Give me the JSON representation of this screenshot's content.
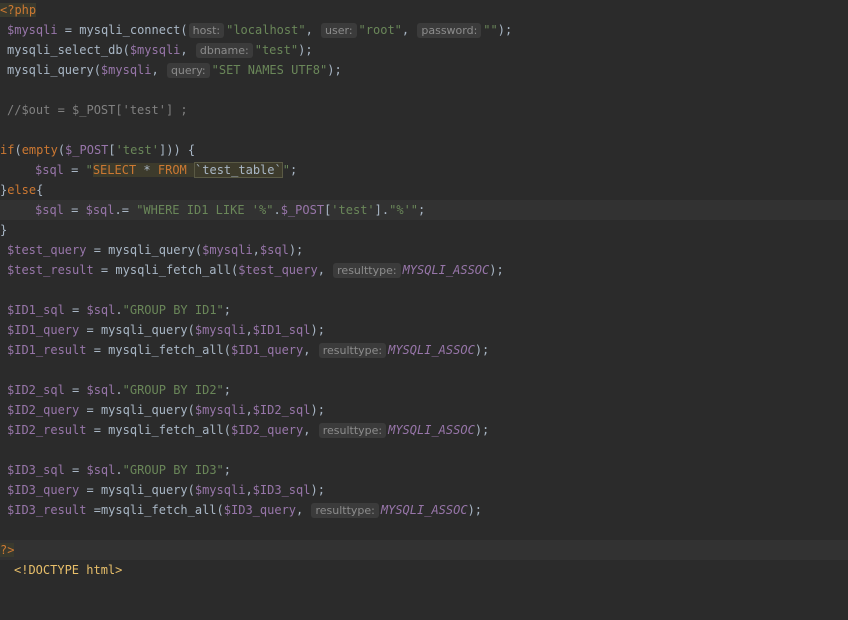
{
  "editor": {
    "lines": {
      "l1": {
        "open_tag": "<?php"
      },
      "l2": {
        "var": "$mysqli",
        "assign": " = ",
        "fn": "mysqli_connect(",
        "hint_host": "host:",
        "arg1": "\"localhost\"",
        "comma1": ", ",
        "hint_user": "user:",
        "arg2": "\"root\"",
        "comma2": ", ",
        "hint_password": "password:",
        "arg3": "\"\"",
        "close": ");"
      },
      "l3": {
        "fn": "mysqli_select_db(",
        "var": "$mysqli",
        "comma": ", ",
        "hint_dbname": "dbname:",
        "arg": "\"test\"",
        "close": ");"
      },
      "l4": {
        "fn": "mysqli_query(",
        "var": "$mysqli",
        "comma": ", ",
        "hint_query": "query:",
        "arg": "\"SET NAMES UTF8\"",
        "close": ");"
      },
      "l6": {
        "comment": "//$out = $_POST['test'] ;"
      },
      "l8": {
        "kw_if": "if",
        "open": "(",
        "fn_empty": "empty",
        "open2": "(",
        "var_post": "$_POST",
        "bracket_open": "[",
        "key": "'test'",
        "bracket_close": "]",
        "close": ")) {"
      },
      "l9": {
        "var": "$sql",
        "assign": " = ",
        "q_open": "\"",
        "sql_select": "SELECT",
        "sql_star": " * ",
        "sql_from": "FROM",
        "sql_space": " ",
        "sql_table": "`test_table`",
        "q_close": "\"",
        "semi": ";"
      },
      "l10": {
        "close_brace": "}",
        "kw_else": "else",
        "open_brace": "{"
      },
      "l11": {
        "var": "$sql",
        "assign": " = ",
        "var2": "$sql",
        "op": ".= ",
        "str1": "\"WHERE ID1 LIKE '%\"",
        "dot1": ".",
        "var_post": "$_POST",
        "b_open": "[",
        "key": "'test'",
        "b_close": "]",
        "dot2": ".",
        "str2": "\"%'\"",
        "semi": ";"
      },
      "l12": {
        "close_brace": "}"
      },
      "l13": {
        "var": "$test_query",
        "assign": " = ",
        "fn": "mysqli_query(",
        "arg1": "$mysqli",
        "comma": ",",
        "arg2": "$sql",
        "close": ");"
      },
      "l14": {
        "var": "$test_result",
        "assign": " = ",
        "fn": "mysqli_fetch_all(",
        "arg1": "$test_query",
        "comma": ", ",
        "hint": "resulttype:",
        "const": "MYSQLI_ASSOC",
        "close": ");"
      },
      "l16": {
        "var": "$ID1_sql",
        "assign": " = ",
        "var2": "$sql",
        "dot": ".",
        "str": "\"GROUP BY ID1\"",
        "semi": ";"
      },
      "l17": {
        "var": "$ID1_query",
        "assign": " = ",
        "fn": "mysqli_query(",
        "arg1": "$mysqli",
        "comma": ",",
        "arg2": "$ID1_sql",
        "close": ");"
      },
      "l18": {
        "var": "$ID1_result",
        "assign": " = ",
        "fn": "mysqli_fetch_all(",
        "arg1": "$ID1_query",
        "comma": ", ",
        "hint": "resulttype:",
        "const": "MYSQLI_ASSOC",
        "close": ");"
      },
      "l20": {
        "var": "$ID2_sql",
        "assign": " = ",
        "var2": "$sql",
        "dot": ".",
        "str": "\"GROUP BY ID2\"",
        "semi": ";"
      },
      "l21": {
        "var": "$ID2_query",
        "assign": " = ",
        "fn": "mysqli_query(",
        "arg1": "$mysqli",
        "comma": ",",
        "arg2": "$ID2_sql",
        "close": ");"
      },
      "l22": {
        "var": "$ID2_result",
        "assign": " = ",
        "fn": "mysqli_fetch_all(",
        "arg1": "$ID2_query",
        "comma": ", ",
        "hint": "resulttype:",
        "const": "MYSQLI_ASSOC",
        "close": ");"
      },
      "l24": {
        "var": "$ID3_sql",
        "assign": " = ",
        "var2": "$sql",
        "dot": ".",
        "str": "\"GROUP BY ID3\"",
        "semi": ";"
      },
      "l25": {
        "var": "$ID3_query",
        "assign": " = ",
        "fn": "mysqli_query(",
        "arg1": "$mysqli",
        "comma": ",",
        "arg2": "$ID3_sql",
        "close": ");"
      },
      "l26": {
        "var": "$ID3_result",
        "assign": " =",
        "fn": "mysqli_fetch_all(",
        "arg1": "$ID3_query",
        "comma": ", ",
        "hint": "resulttype:",
        "const": "MYSQLI_ASSOC",
        "close": ");"
      },
      "l28": {
        "close_tag": "?>"
      },
      "l29": {
        "partial": "<!DOCTYPE html>"
      }
    }
  }
}
